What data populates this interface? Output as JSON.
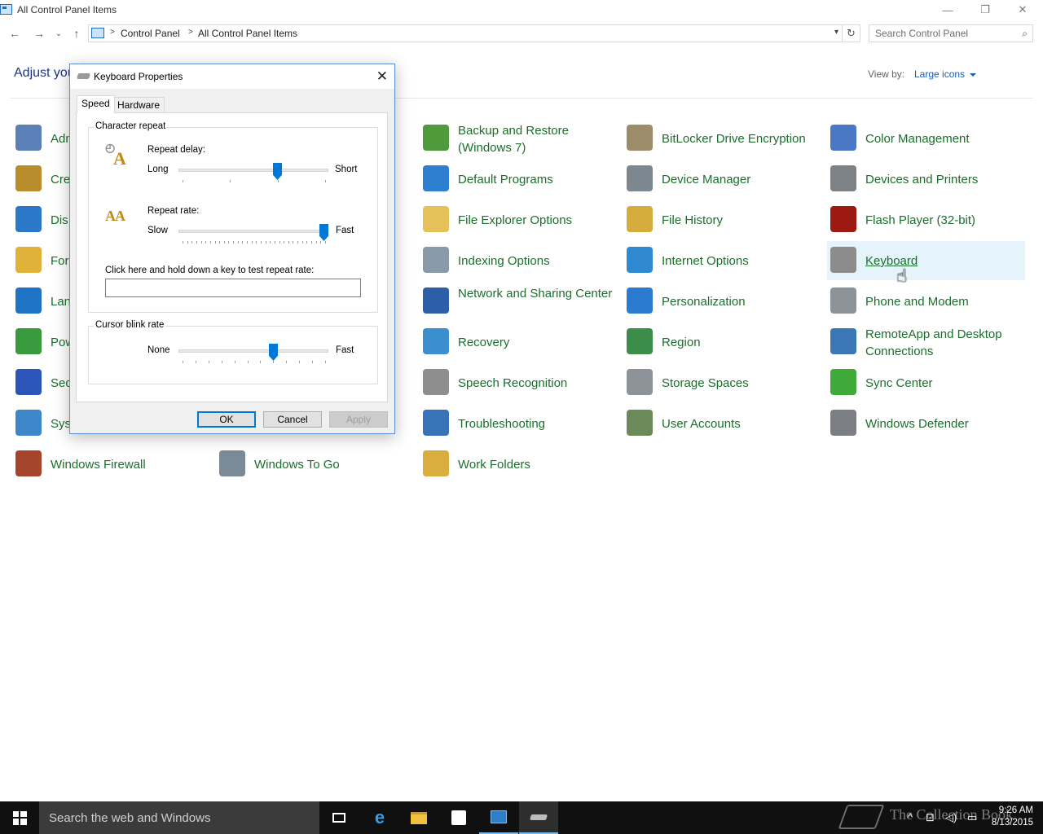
{
  "window": {
    "title": "All Control Panel Items",
    "minimize_glyph": "—",
    "restore_glyph": "❐",
    "close_glyph": "✕"
  },
  "nav": {
    "back_glyph": "←",
    "forward_glyph": "→",
    "recent_glyph": "⌄",
    "up_glyph": "↑",
    "breadcrumb": [
      "Control Panel",
      "All Control Panel Items"
    ],
    "crumb_sep": ">",
    "refresh_glyph": "↻",
    "search_placeholder": "Search Control Panel"
  },
  "header": {
    "title_visible": "Adjust you",
    "view_by_label": "View by:",
    "view_by_value": "Large icons"
  },
  "items": [
    {
      "label": "Adm",
      "icon": "admin-tools-icon",
      "color": "#5b7fb7"
    },
    {
      "label": "Cre",
      "icon": "credential-manager-icon",
      "color": "#b98c2c"
    },
    {
      "label": "Dis",
      "icon": "display-icon",
      "color": "#2b78c8"
    },
    {
      "label": "For",
      "icon": "fonts-icon",
      "color": "#e1b23a"
    },
    {
      "label": "Lan",
      "icon": "language-icon",
      "color": "#1f73c4"
    },
    {
      "label": "Pow",
      "icon": "power-options-icon",
      "color": "#3a9b3e"
    },
    {
      "label": "Sec",
      "icon": "security-flag-icon",
      "color": "#2b55b8"
    },
    {
      "label": "Sys",
      "icon": "system-icon",
      "color": "#3d86c8"
    },
    {
      "label": "Windows Firewall",
      "icon": "firewall-icon",
      "color": "#a5462c"
    },
    {
      "label": "Windows To Go",
      "icon": "windows-to-go-icon",
      "color": "#7b8a99"
    },
    {
      "label": "Backup and Restore (Windows 7)",
      "icon": "backup-restore-icon",
      "color": "#4f9a3a"
    },
    {
      "label": "Default Programs",
      "icon": "default-programs-icon",
      "color": "#2e7fcf"
    },
    {
      "label": "File Explorer Options",
      "icon": "folder-options-icon",
      "color": "#e5c15a"
    },
    {
      "label": "Indexing Options",
      "icon": "indexing-icon",
      "color": "#8a9aa9"
    },
    {
      "label": "Network and Sharing Center",
      "icon": "network-icon",
      "color": "#2d5fa8"
    },
    {
      "label": "Recovery",
      "icon": "recovery-icon",
      "color": "#3a8fcc"
    },
    {
      "label": "Speech Recognition",
      "icon": "microphone-icon",
      "color": "#8e8e8e"
    },
    {
      "label": "Troubleshooting",
      "icon": "troubleshooting-icon",
      "color": "#3873b8"
    },
    {
      "label": "Work Folders",
      "icon": "work-folders-icon",
      "color": "#d9ad3e"
    },
    {
      "label": "BitLocker Drive Encryption",
      "icon": "bitlocker-icon",
      "color": "#9c8c6a"
    },
    {
      "label": "Device Manager",
      "icon": "device-manager-icon",
      "color": "#7d8790"
    },
    {
      "label": "File History",
      "icon": "file-history-icon",
      "color": "#d6ad3c"
    },
    {
      "label": "Internet Options",
      "icon": "internet-options-icon",
      "color": "#2f8ad2"
    },
    {
      "label": "Personalization",
      "icon": "personalization-icon",
      "color": "#2b7bd0"
    },
    {
      "label": "Region",
      "icon": "region-icon",
      "color": "#3c8c4a"
    },
    {
      "label": "Storage Spaces",
      "icon": "storage-spaces-icon",
      "color": "#8d9399"
    },
    {
      "label": "User Accounts",
      "icon": "user-accounts-icon",
      "color": "#6a8a5a"
    },
    {
      "label": "Color Management",
      "icon": "color-management-icon",
      "color": "#4a78c4"
    },
    {
      "label": "Devices and Printers",
      "icon": "printer-icon",
      "color": "#7d8287"
    },
    {
      "label": "Flash Player (32-bit)",
      "icon": "flash-player-icon",
      "color": "#9c1a12"
    },
    {
      "label": "Keyboard",
      "icon": "keyboard-icon",
      "color": "#8c8c8c"
    },
    {
      "label": "Phone and Modem",
      "icon": "phone-modem-icon",
      "color": "#8c949a"
    },
    {
      "label": "RemoteApp and Desktop Connections",
      "icon": "remoteapp-icon",
      "color": "#3b76b6"
    },
    {
      "label": "Sync Center",
      "icon": "sync-center-icon",
      "color": "#3faa3a"
    },
    {
      "label": "Windows Defender",
      "icon": "windows-defender-icon",
      "color": "#7b7f84"
    }
  ],
  "dialog": {
    "title": "Keyboard Properties",
    "close_glyph": "✕",
    "tabs": [
      "Speed",
      "Hardware"
    ],
    "character_repeat": {
      "group_label": "Character repeat",
      "repeat_delay_label": "Repeat delay:",
      "repeat_delay_min": "Long",
      "repeat_delay_max": "Short",
      "repeat_delay_value": 0.67,
      "repeat_rate_label": "Repeat rate:",
      "repeat_rate_min": "Slow",
      "repeat_rate_max": "Fast",
      "repeat_rate_value": 1.0,
      "test_label": "Click here and hold down a key to test repeat rate:"
    },
    "cursor_blink": {
      "group_label": "Cursor blink rate",
      "min": "None",
      "max": "Fast",
      "value": 0.64
    },
    "buttons": {
      "ok": "OK",
      "cancel": "Cancel",
      "apply": "Apply"
    }
  },
  "taskbar": {
    "search_text": "Search the web and Windows",
    "time": "9:26 AM",
    "date": "8/13/2015",
    "watermark": "The Collection Book"
  }
}
